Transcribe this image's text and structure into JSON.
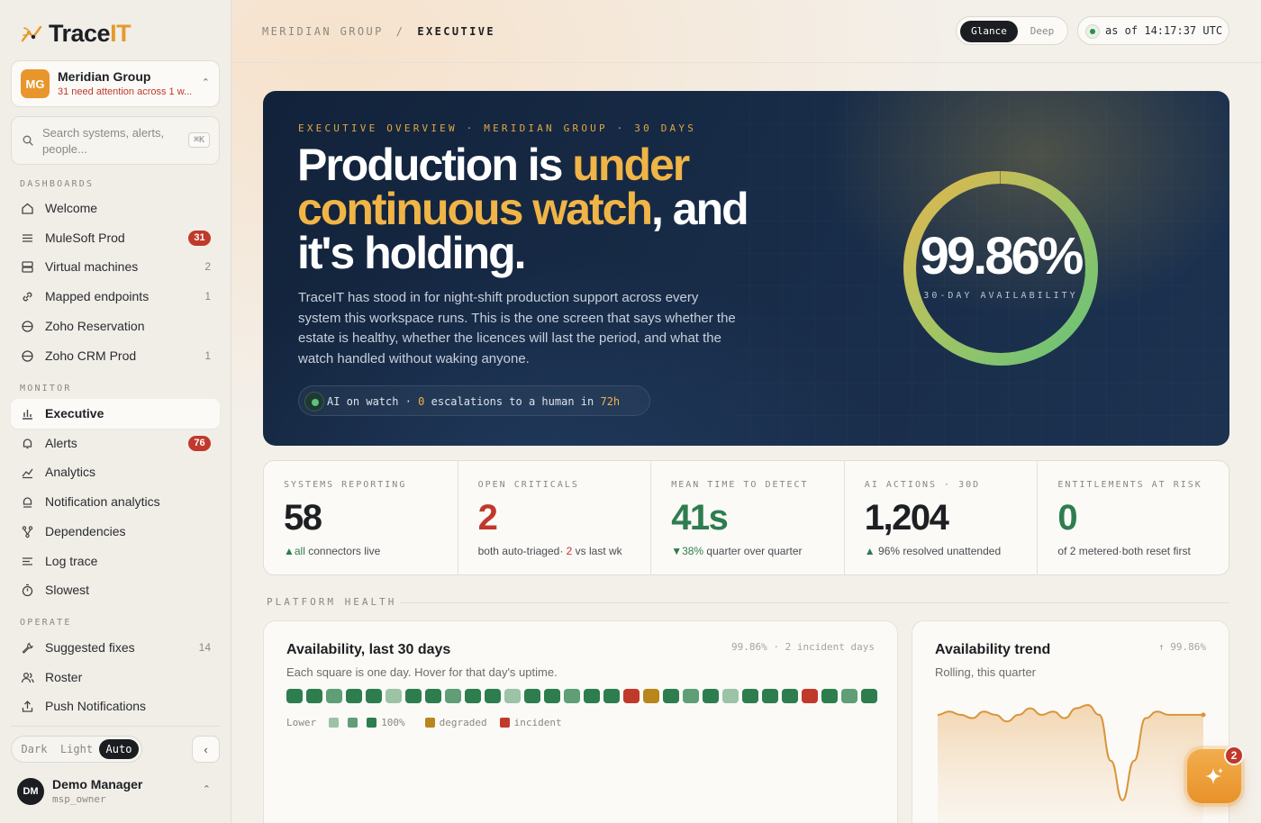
{
  "brand": {
    "name_prefix": "Trace",
    "name_suffix": "IT",
    "accent": "#e59a2b"
  },
  "workspace": {
    "initials": "MG",
    "name": "Meridian Group",
    "subtitle": "31 need attention across 1 w..."
  },
  "search": {
    "placeholder": "Search systems, alerts, people...",
    "shortcut": "⌘K"
  },
  "sidebar": {
    "sections": {
      "dashboards": "DASHBOARDS",
      "monitor": "MONITOR",
      "operate": "OPERATE"
    },
    "dashboards": [
      {
        "label": "Welcome",
        "icon": "home-icon",
        "count": ""
      },
      {
        "label": "MuleSoft Prod",
        "icon": "list-icon",
        "badge": "31"
      },
      {
        "label": "Virtual machines",
        "icon": "server-icon",
        "count": "2"
      },
      {
        "label": "Mapped endpoints",
        "icon": "link-icon",
        "count": "1"
      },
      {
        "label": "Zoho Reservation",
        "icon": "circle-minus-icon",
        "count": ""
      },
      {
        "label": "Zoho CRM Prod",
        "icon": "circle-minus-icon",
        "count": "1"
      }
    ],
    "monitor": [
      {
        "label": "Executive",
        "icon": "bar-chart-icon",
        "active": true
      },
      {
        "label": "Alerts",
        "icon": "bell-icon",
        "badge": "76"
      },
      {
        "label": "Analytics",
        "icon": "line-chart-icon"
      },
      {
        "label": "Notification analytics",
        "icon": "bell-chart-icon"
      },
      {
        "label": "Dependencies",
        "icon": "branch-icon"
      },
      {
        "label": "Log trace",
        "icon": "log-icon"
      },
      {
        "label": "Slowest",
        "icon": "stopwatch-icon"
      }
    ],
    "operate": [
      {
        "label": "Suggested fixes",
        "icon": "wrench-icon",
        "count": "14"
      },
      {
        "label": "Roster",
        "icon": "users-icon"
      },
      {
        "label": "Push Notifications",
        "icon": "upload-icon"
      }
    ],
    "theme": {
      "dark": "Dark",
      "light": "Light",
      "auto": "Auto",
      "selected": "Auto"
    },
    "collapse_glyph": "‹",
    "user": {
      "initials": "DM",
      "name": "Demo Manager",
      "role": "msp_owner"
    }
  },
  "topbar": {
    "breadcrumb_root": "MERIDIAN GROUP",
    "breadcrumb_sep": "/",
    "breadcrumb_current": "EXECUTIVE",
    "mode": {
      "glance": "Glance",
      "deep": "Deep",
      "selected": "Glance"
    },
    "as_of": "as of 14:17:37 UTC"
  },
  "hero": {
    "eyebrow": "EXECUTIVE OVERVIEW · MERIDIAN GROUP · 30 DAYS",
    "title_part1": "Production is ",
    "title_highlight": "under continuous watch",
    "title_part2": ", and it's holding.",
    "description": "TraceIT has stood in for night-shift production support across every system this workspace runs. This is the one screen that says whether the estate is healthy, whether the licences will last the period, and what the watch handled without waking anyone.",
    "watch_prefix": "AI on watch · ",
    "watch_count": "0",
    "watch_middle": " escalations to a human in ",
    "watch_window": "72h",
    "availability_value": "99.86%",
    "availability_label": "30-DAY AVAILABILITY",
    "availability_fraction": 0.9986
  },
  "kpis": [
    {
      "label": "SYSTEMS REPORTING",
      "value": "58",
      "sub_accent": "▲all",
      "sub_text": "connectors live"
    },
    {
      "label": "OPEN CRITICALS",
      "value": "2",
      "sub_text": "both auto-triaged· ",
      "sub_accent": "2",
      "sub_tail": " vs last wk"
    },
    {
      "label": "MEAN TIME TO DETECT",
      "value": "41s",
      "sub_accent": "▼38%",
      "sub_text": " quarter over quarter"
    },
    {
      "label": "AI ACTIONS · 30D",
      "value": "1,204",
      "sub_accent": "▲",
      "sub_text": " 96% resolved unattended"
    },
    {
      "label": "ENTITLEMENTS AT RISK",
      "value": "0",
      "sub_text": "of 2 metered·both reset first"
    }
  ],
  "platform_health": {
    "label": "PLATFORM HEALTH",
    "availability_card": {
      "title": "Availability, last 30 days",
      "subtitle": "Each square is one day. Hover for that day's uptime.",
      "meta": "99.86% · 2 incident days",
      "days": [
        "ok",
        "ok",
        "ok-mid",
        "ok",
        "ok",
        "ok-low",
        "ok",
        "ok",
        "ok-mid",
        "ok",
        "ok",
        "ok-low",
        "ok",
        "ok",
        "ok-mid",
        "ok",
        "ok",
        "incident",
        "degraded",
        "ok",
        "ok-mid",
        "ok",
        "ok-low",
        "ok",
        "ok",
        "ok",
        "incident",
        "ok",
        "ok-mid",
        "ok"
      ],
      "colors": {
        "ok": "#2e7d4f",
        "ok-mid": "#5f9e76",
        "ok-low": "#9cc3a5",
        "degraded": "#b8861b",
        "incident": "#c0392b"
      },
      "legend_lower": "Lower",
      "legend_full": "100%",
      "legend_degraded": "degraded",
      "legend_incident": "incident"
    },
    "trend_card": {
      "title": "Availability trend",
      "subtitle": "Rolling, this quarter",
      "meta": "↑ 99.86%"
    }
  },
  "assistant": {
    "badge": "2"
  },
  "chart_data": {
    "type": "area",
    "title": "Availability trend",
    "subtitle": "Rolling, this quarter",
    "series": [
      {
        "values": [
          99.86,
          99.87,
          99.86,
          99.85,
          99.87,
          99.86,
          99.84,
          99.86,
          99.88,
          99.86,
          99.87,
          99.85,
          99.88,
          99.89,
          99.86,
          99.72,
          99.6,
          99.72,
          99.85,
          99.87,
          99.86,
          99.86,
          99.86,
          99.86
        ]
      }
    ],
    "ylim": [
      99.55,
      99.92
    ],
    "grid": false
  }
}
